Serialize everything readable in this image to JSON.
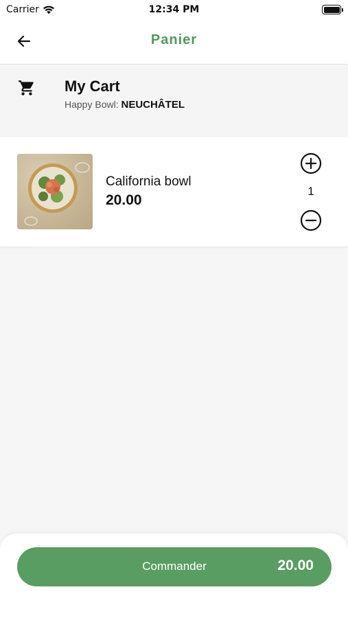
{
  "status_bar": {
    "carrier": "Carrier",
    "time": "12:34 PM"
  },
  "app_bar": {
    "title": "Panier",
    "back_icon": "arrow-left-icon"
  },
  "cart": {
    "icon": "shopping-cart-icon",
    "title": "My Cart",
    "restaurant_label": "Happy Bowl:",
    "restaurant_name": "NEUCHÂTEL"
  },
  "items": [
    {
      "name": "California bowl",
      "price": "20.00",
      "quantity": "1",
      "plus_icon": "plus-circle-icon",
      "minus_icon": "minus-circle-icon"
    }
  ],
  "footer": {
    "order_label": "Commander",
    "total": "20.00"
  },
  "colors": {
    "accent": "#5a9d62",
    "title_green": "#4f9a5b"
  }
}
